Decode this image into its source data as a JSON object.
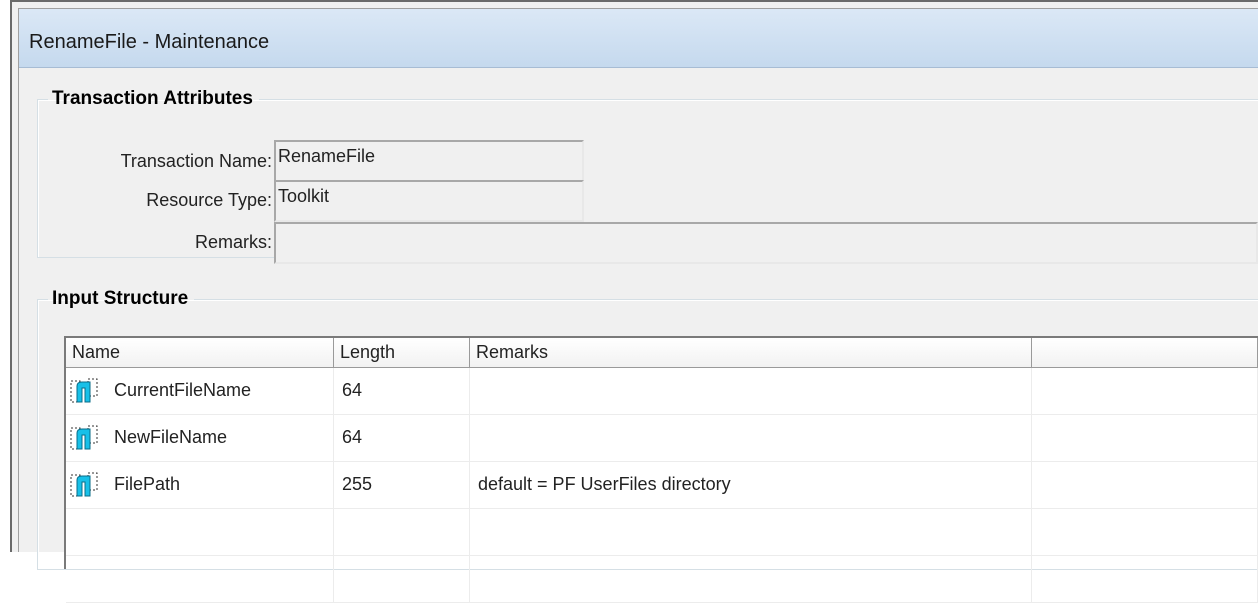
{
  "window": {
    "title": "RenameFile - Maintenance"
  },
  "transaction_attributes": {
    "legend": "Transaction Attributes",
    "fields": {
      "transaction_name": {
        "label": "Transaction Name:",
        "value": "RenameFile"
      },
      "resource_type": {
        "label": "Resource Type:",
        "value": "Toolkit"
      },
      "remarks": {
        "label": "Remarks:",
        "value": ""
      }
    }
  },
  "input_structure": {
    "legend": "Input Structure",
    "columns": [
      "Name",
      "Length",
      "Remarks",
      ""
    ],
    "rows": [
      {
        "icon": "field-icon",
        "name": "CurrentFileName",
        "length": "64",
        "remarks": ""
      },
      {
        "icon": "field-icon",
        "name": "NewFileName",
        "length": "64",
        "remarks": ""
      },
      {
        "icon": "field-icon",
        "name": "FilePath",
        "length": "255",
        "remarks": "default = PF UserFiles directory"
      }
    ]
  },
  "colors": {
    "titlebar": "#c5d9ee",
    "icon_accent": "#17c0e8",
    "panel_bg": "#f0f0f0"
  }
}
